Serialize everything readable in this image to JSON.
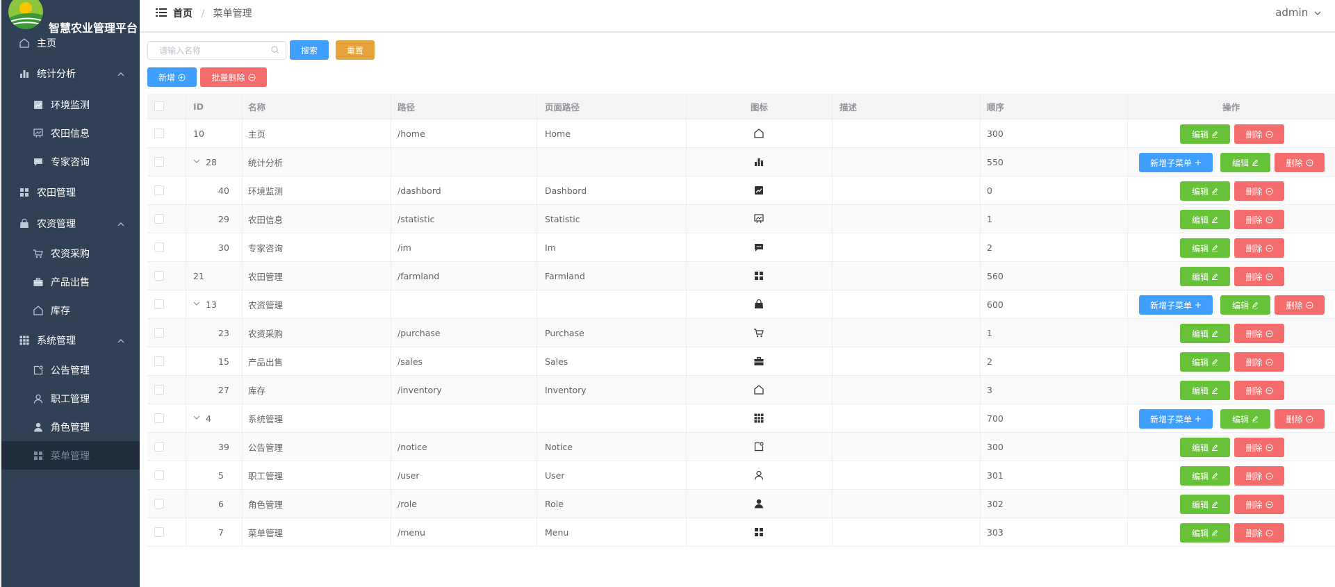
{
  "app": {
    "title": "智慧农业管理平台"
  },
  "sidebar": {
    "items": [
      {
        "label": "主页",
        "icon": "home-icon",
        "level": "top"
      },
      {
        "label": "统计分析",
        "icon": "bar-chart-icon",
        "level": "top",
        "expanded": true
      },
      {
        "label": "环境监测",
        "icon": "trend-chart-icon",
        "level": "sub"
      },
      {
        "label": "农田信息",
        "icon": "presentation-icon",
        "level": "sub"
      },
      {
        "label": "专家咨询",
        "icon": "chat-icon",
        "level": "sub"
      },
      {
        "label": "农田管理",
        "icon": "grid-icon",
        "level": "top"
      },
      {
        "label": "农资管理",
        "icon": "bag-icon",
        "level": "top",
        "expanded": true
      },
      {
        "label": "农资采购",
        "icon": "cart-icon",
        "level": "sub"
      },
      {
        "label": "产品出售",
        "icon": "briefcase-icon",
        "level": "sub"
      },
      {
        "label": "库存",
        "icon": "home-icon",
        "level": "sub"
      },
      {
        "label": "系统管理",
        "icon": "apps-icon",
        "level": "top",
        "expanded": true
      },
      {
        "label": "公告管理",
        "icon": "notice-icon",
        "level": "sub"
      },
      {
        "label": "职工管理",
        "icon": "user-icon",
        "level": "sub"
      },
      {
        "label": "角色管理",
        "icon": "user-filled-icon",
        "level": "sub"
      },
      {
        "label": "菜单管理",
        "icon": "grid-icon",
        "level": "sub",
        "active": true
      }
    ]
  },
  "header": {
    "breadcrumb": [
      "首页",
      "菜单管理"
    ],
    "user": "admin"
  },
  "toolbar": {
    "search_placeholder": "请输入名称",
    "search_label": "搜索",
    "reset_label": "重置",
    "add_label": "新增",
    "batch_delete_label": "批量删除"
  },
  "table": {
    "columns": [
      "ID",
      "名称",
      "路径",
      "页面路径",
      "图标",
      "描述",
      "顺序",
      "操作"
    ],
    "rows": [
      {
        "id": "10",
        "name": "主页",
        "path": "/home",
        "page": "Home",
        "icon": "home-icon",
        "desc": "",
        "order": "300",
        "child": false,
        "parent": false
      },
      {
        "id": "28",
        "name": "统计分析",
        "path": "",
        "page": "",
        "icon": "bar-chart-icon",
        "desc": "",
        "order": "550",
        "child": false,
        "parent": true
      },
      {
        "id": "40",
        "name": "环境监测",
        "path": "/dashbord",
        "page": "Dashbord",
        "icon": "trend-chart-icon",
        "desc": "",
        "order": "0",
        "child": true,
        "parent": false
      },
      {
        "id": "29",
        "name": "农田信息",
        "path": "/statistic",
        "page": "Statistic",
        "icon": "presentation-icon",
        "desc": "",
        "order": "1",
        "child": true,
        "parent": false
      },
      {
        "id": "30",
        "name": "专家咨询",
        "path": "/im",
        "page": "Im",
        "icon": "chat-icon",
        "desc": "",
        "order": "2",
        "child": true,
        "parent": false
      },
      {
        "id": "21",
        "name": "农田管理",
        "path": "/farmland",
        "page": "Farmland",
        "icon": "grid-icon",
        "desc": "",
        "order": "560",
        "child": false,
        "parent": false
      },
      {
        "id": "13",
        "name": "农资管理",
        "path": "",
        "page": "",
        "icon": "bag-icon",
        "desc": "",
        "order": "600",
        "child": false,
        "parent": true
      },
      {
        "id": "23",
        "name": "农资采购",
        "path": "/purchase",
        "page": "Purchase",
        "icon": "cart-icon",
        "desc": "",
        "order": "1",
        "child": true,
        "parent": false
      },
      {
        "id": "15",
        "name": "产品出售",
        "path": "/sales",
        "page": "Sales",
        "icon": "briefcase-icon",
        "desc": "",
        "order": "2",
        "child": true,
        "parent": false
      },
      {
        "id": "27",
        "name": "库存",
        "path": "/inventory",
        "page": "Inventory",
        "icon": "home-icon",
        "desc": "",
        "order": "3",
        "child": true,
        "parent": false
      },
      {
        "id": "4",
        "name": "系统管理",
        "path": "",
        "page": "",
        "icon": "apps-icon",
        "desc": "",
        "order": "700",
        "child": false,
        "parent": true
      },
      {
        "id": "39",
        "name": "公告管理",
        "path": "/notice",
        "page": "Notice",
        "icon": "notice-icon",
        "desc": "",
        "order": "300",
        "child": true,
        "parent": false
      },
      {
        "id": "5",
        "name": "职工管理",
        "path": "/user",
        "page": "User",
        "icon": "user-icon",
        "desc": "",
        "order": "301",
        "child": true,
        "parent": false
      },
      {
        "id": "6",
        "name": "角色管理",
        "path": "/role",
        "page": "Role",
        "icon": "user-filled-icon",
        "desc": "",
        "order": "302",
        "child": true,
        "parent": false
      },
      {
        "id": "7",
        "name": "菜单管理",
        "path": "/menu",
        "page": "Menu",
        "icon": "grid-icon",
        "desc": "",
        "order": "303",
        "child": true,
        "parent": false
      }
    ],
    "actions": {
      "add_child": "新增子菜单",
      "edit": "编辑",
      "delete": "删除"
    }
  },
  "colors": {
    "sidebar_bg": "#304156",
    "primary": "#409eff",
    "success": "#67c23a",
    "danger": "#f56c6c",
    "warning": "#e6a23c"
  }
}
